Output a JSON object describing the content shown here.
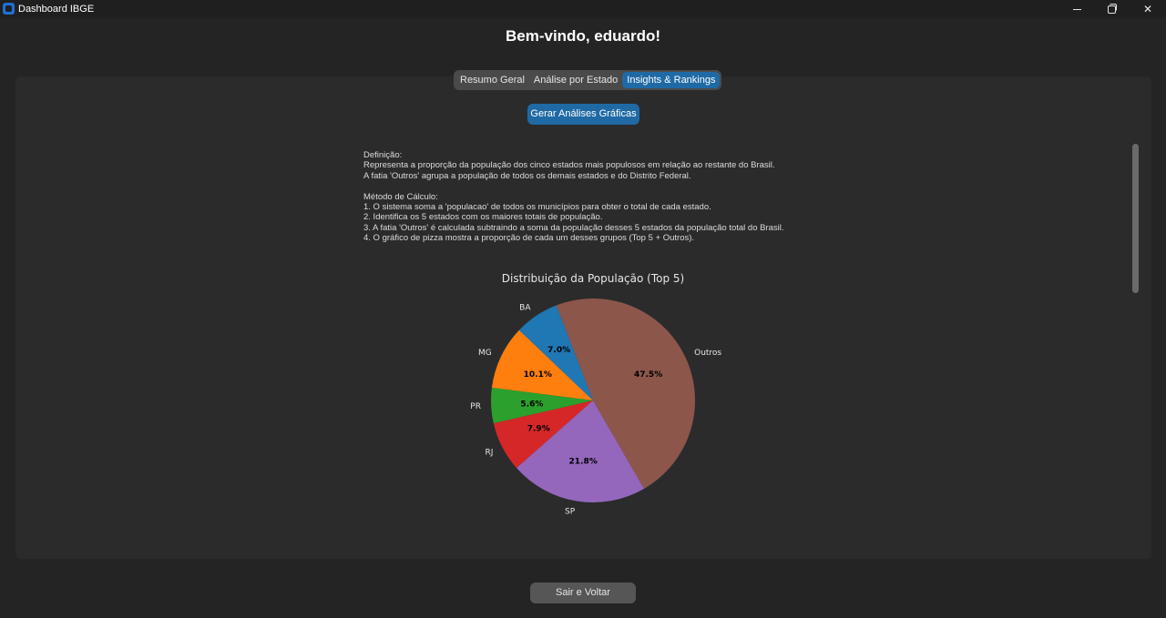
{
  "window": {
    "title": "Dashboard IBGE",
    "minimize_icon": "minimize-icon",
    "maximize_icon": "restore-icon",
    "close_icon": "close-icon",
    "close_glyph": "✕"
  },
  "header": {
    "welcome": "Bem-vindo, eduardo!"
  },
  "tabs": [
    {
      "label": "Resumo Geral",
      "active": false
    },
    {
      "label": "Análise por Estado",
      "active": false
    },
    {
      "label": "Insights & Rankings",
      "active": true
    }
  ],
  "generate_button": "Gerar Análises Gráficas",
  "description": {
    "definition_title": "Definição:",
    "definition_lines": [
      "Representa a proporção da população dos cinco estados mais populosos em relação ao restante do Brasil.",
      "A fatia 'Outros' agrupa a população de todos os demais estados e do Distrito Federal."
    ],
    "method_title": "Método de Cálculo:",
    "method_lines": [
      "1. O sistema soma a 'populacao' de todos os municípios para obter o total de cada estado.",
      "2. Identifica os 5 estados com os maiores totais de população.",
      "3. A fatia 'Outros' é calculada subtraindo a soma da população desses 5 estados da população total do Brasil.",
      "4. O gráfico de pizza mostra a proporção de cada um desses grupos (Top 5 + Outros)."
    ]
  },
  "chart_data": {
    "type": "pie",
    "title": "Distribuição da População (Top 5)",
    "slices": [
      {
        "label": "Outros",
        "value": 47.5,
        "pct_label": "47.5%",
        "color": "#8c564b"
      },
      {
        "label": "BA",
        "value": 7.0,
        "pct_label": "7.0%",
        "color": "#1f77b4"
      },
      {
        "label": "MG",
        "value": 10.1,
        "pct_label": "10.1%",
        "color": "#ff7f0e"
      },
      {
        "label": "PR",
        "value": 5.6,
        "pct_label": "5.6%",
        "color": "#2ca02c"
      },
      {
        "label": "RJ",
        "value": 7.9,
        "pct_label": "7.9%",
        "color": "#d62728"
      },
      {
        "label": "SP",
        "value": 21.8,
        "pct_label": "21.8%",
        "color": "#9467bd"
      }
    ],
    "start_angle_deg": -60,
    "direction": "counterclockwise"
  },
  "exit_button": "Sair e Voltar"
}
